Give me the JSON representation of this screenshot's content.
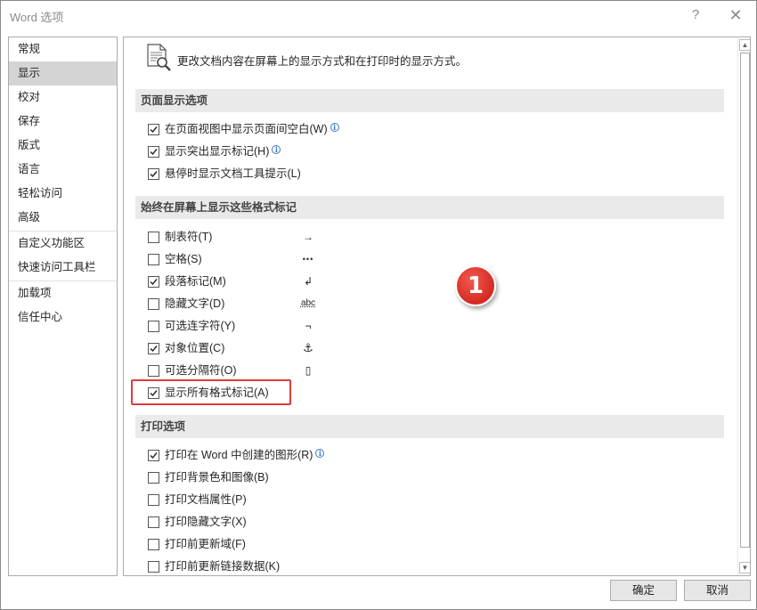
{
  "window": {
    "title": "Word 选项",
    "help": "?",
    "close": "✕"
  },
  "nav": {
    "items": [
      {
        "label": "常规"
      },
      {
        "label": "显示",
        "active": true
      },
      {
        "label": "校对"
      },
      {
        "label": "保存"
      },
      {
        "label": "版式"
      },
      {
        "label": "语言"
      },
      {
        "label": "轻松访问"
      },
      {
        "label": "高级"
      },
      {
        "label": "自定义功能区"
      },
      {
        "label": "快速访问工具栏"
      },
      {
        "label": "加载项"
      },
      {
        "label": "信任中心"
      }
    ]
  },
  "content": {
    "intro": "更改文档内容在屏幕上的显示方式和在打印时的显示方式。",
    "page_display": {
      "header": "页面显示选项",
      "options": [
        {
          "label": "在页面视图中显示页面间空白(W)",
          "checked": true
        },
        {
          "label": "显示突出显示标记(H)",
          "checked": true
        },
        {
          "label": "悬停时显示文档工具提示(L)",
          "checked": true
        }
      ]
    },
    "format_marks": {
      "header": "始终在屏幕上显示这些格式标记",
      "options": [
        {
          "label": "制表符(T)",
          "checked": false,
          "mark": "→"
        },
        {
          "label": "空格(S)",
          "checked": false,
          "mark": "•••"
        },
        {
          "label": "段落标记(M)",
          "checked": true,
          "mark": "↲"
        },
        {
          "label": "隐藏文字(D)",
          "checked": false,
          "mark": "abc"
        },
        {
          "label": "可选连字符(Y)",
          "checked": false,
          "mark": "¬"
        },
        {
          "label": "对象位置(C)",
          "checked": true,
          "mark": "⚓"
        },
        {
          "label": "可选分隔符(O)",
          "checked": false,
          "mark": "▯"
        },
        {
          "label": "显示所有格式标记(A)",
          "checked": true
        }
      ]
    },
    "print": {
      "header": "打印选项",
      "options": [
        {
          "label": "打印在 Word 中创建的图形(R)",
          "checked": true
        },
        {
          "label": "打印背景色和图像(B)",
          "checked": false
        },
        {
          "label": "打印文档属性(P)",
          "checked": false
        },
        {
          "label": "打印隐藏文字(X)",
          "checked": false
        },
        {
          "label": "打印前更新域(F)",
          "checked": false
        },
        {
          "label": "打印前更新链接数据(K)",
          "checked": false
        }
      ]
    },
    "badge": "1"
  },
  "buttons": {
    "ok": "确定",
    "cancel": "取消"
  },
  "colors": {
    "highlight_border": "#e03c3c",
    "badge_fill": "#d42a22",
    "section_header_bg": "#eaeaea",
    "nav_active_bg": "#d4d4d4",
    "info_icon": "#3a79c4"
  }
}
